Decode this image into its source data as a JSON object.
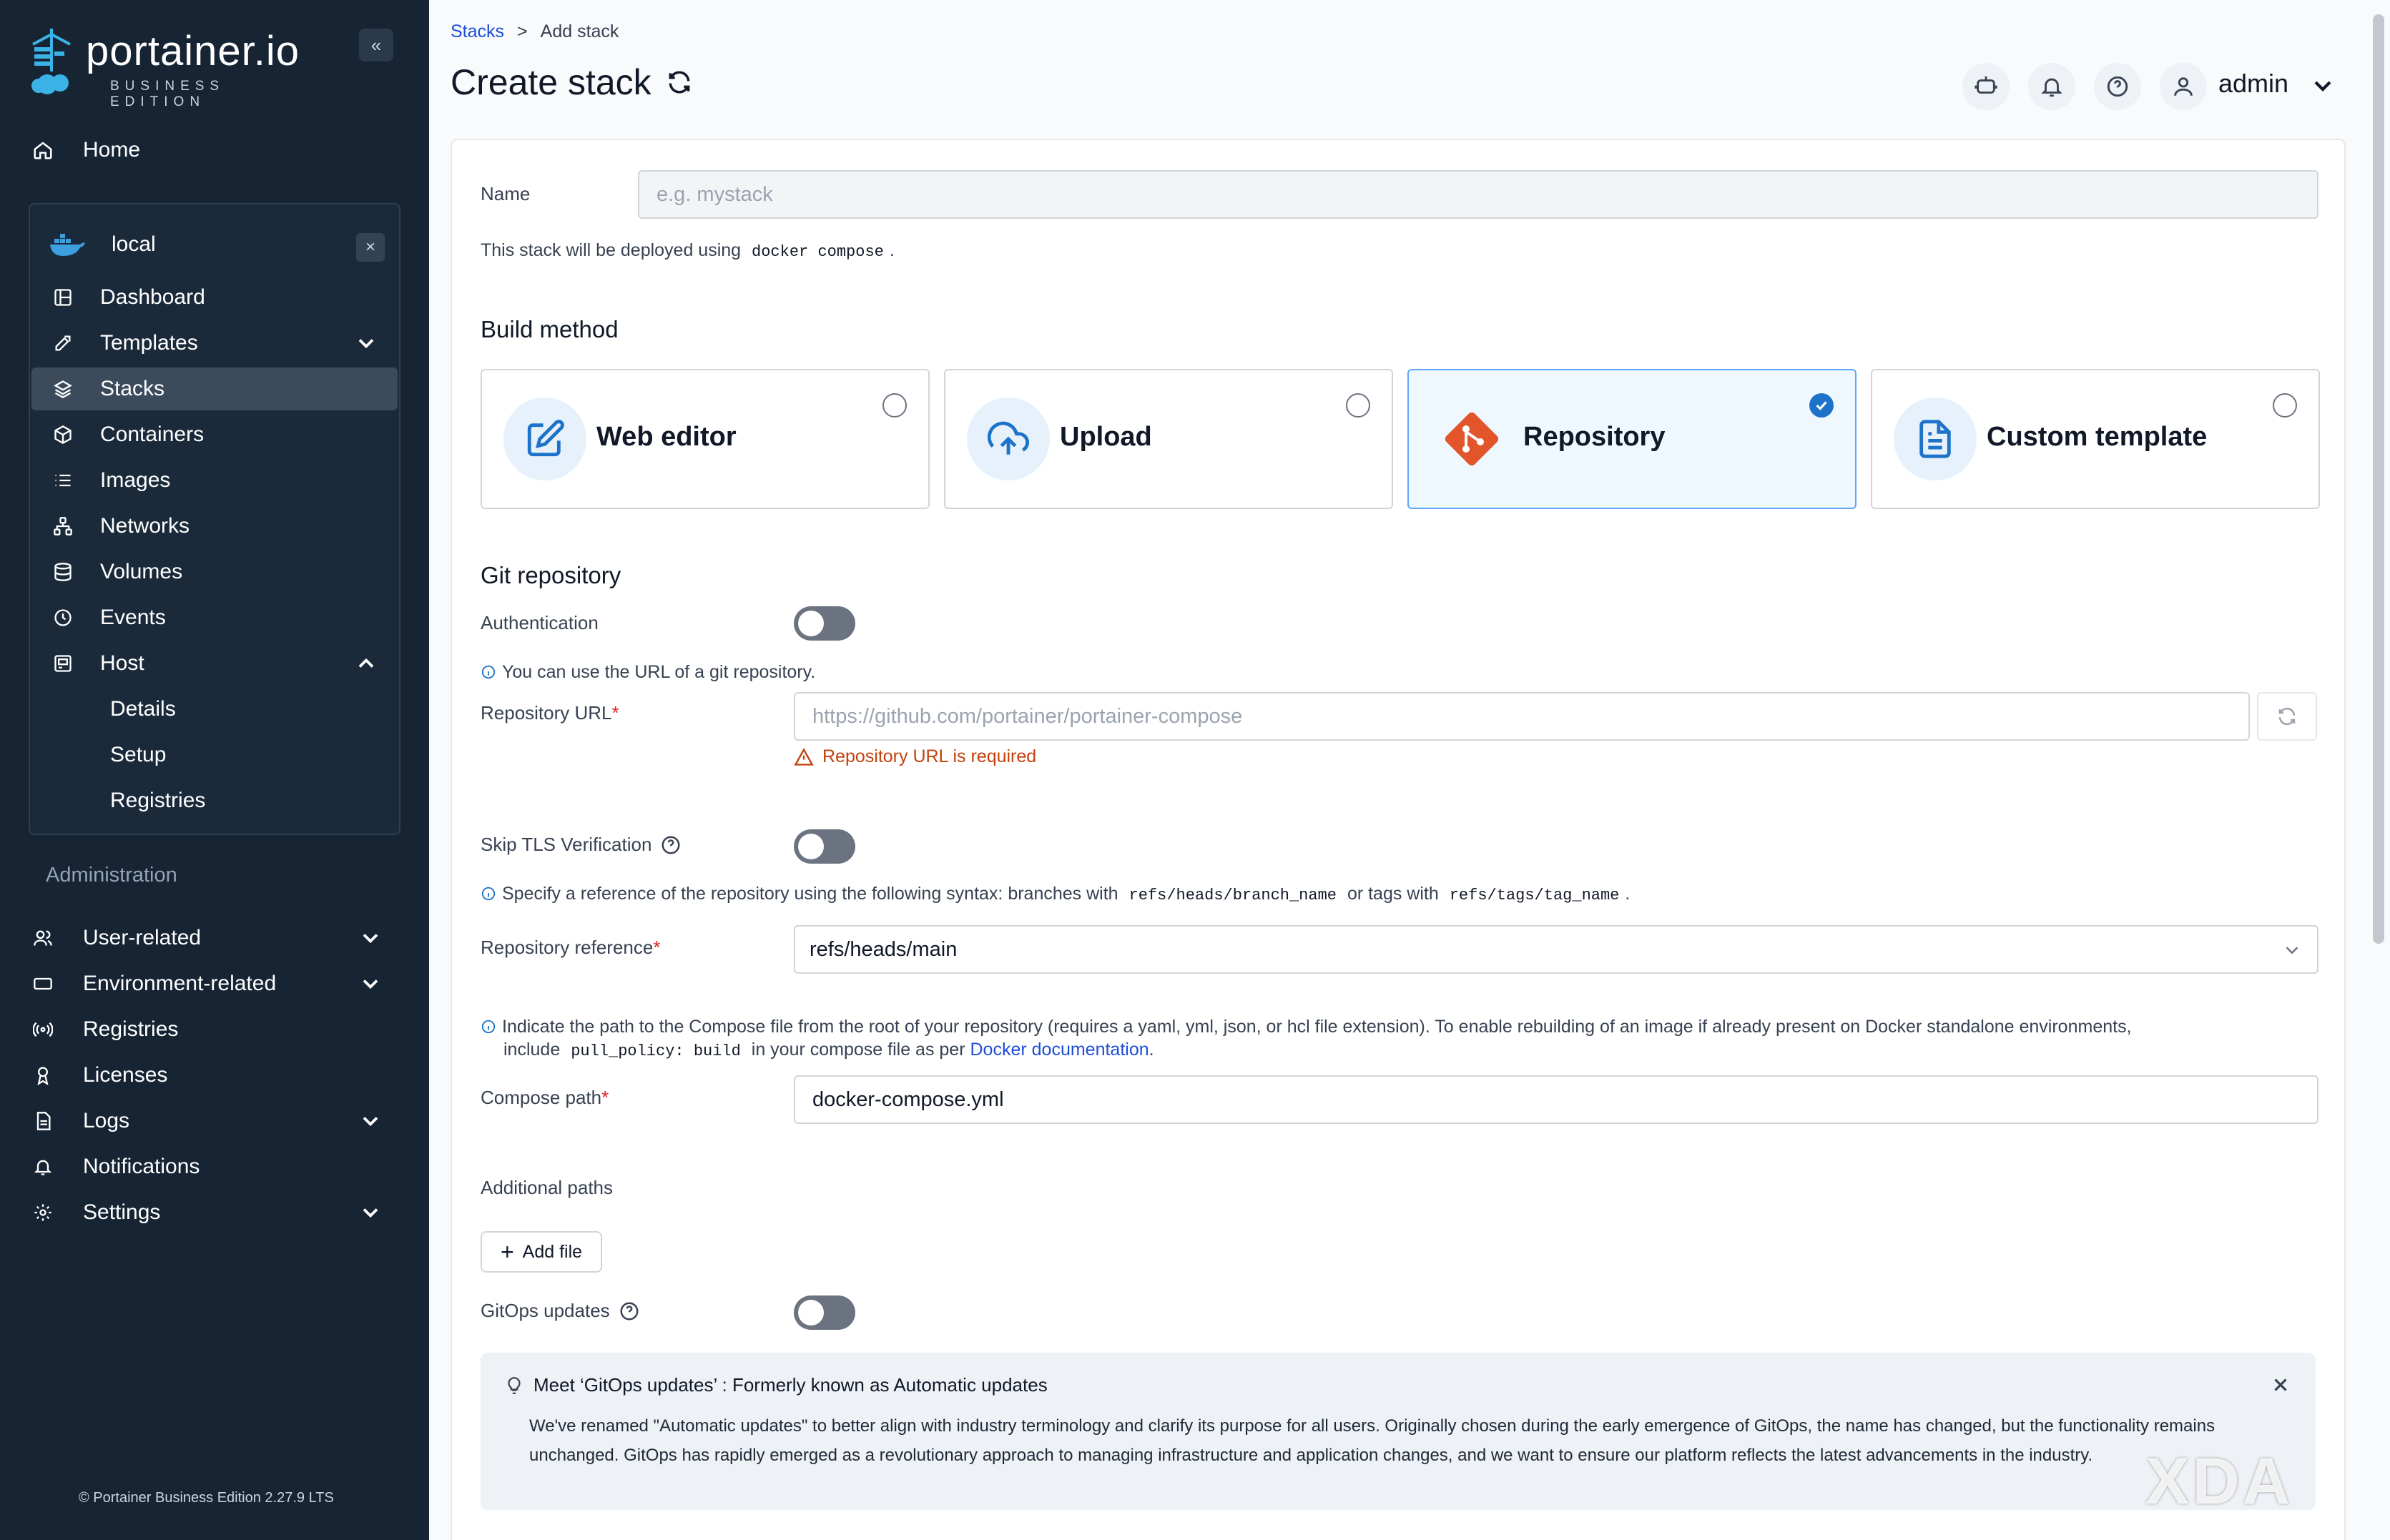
{
  "app": {
    "logo_text": "portainer.io",
    "logo_sub": "BUSINESS EDITION",
    "version_note": "© Portainer Business Edition 2.27.9 LTS"
  },
  "sidebar": {
    "home": "Home",
    "environment": {
      "name": "local",
      "items": [
        {
          "label": "Dashboard",
          "icon": "dashboard-icon"
        },
        {
          "label": "Templates",
          "icon": "templates-icon",
          "expandable": true
        },
        {
          "label": "Stacks",
          "icon": "stacks-icon",
          "active": true
        },
        {
          "label": "Containers",
          "icon": "containers-icon"
        },
        {
          "label": "Images",
          "icon": "images-icon"
        },
        {
          "label": "Networks",
          "icon": "networks-icon"
        },
        {
          "label": "Volumes",
          "icon": "volumes-icon"
        },
        {
          "label": "Events",
          "icon": "events-icon"
        },
        {
          "label": "Host",
          "icon": "host-icon",
          "expanded": true
        }
      ],
      "host_sub": [
        "Details",
        "Setup",
        "Registries"
      ]
    },
    "admin_label": "Administration",
    "admin_items": [
      {
        "label": "User-related",
        "icon": "user-icon",
        "expandable": true
      },
      {
        "label": "Environment-related",
        "icon": "environment-icon",
        "expandable": true
      },
      {
        "label": "Registries",
        "icon": "registries-icon"
      },
      {
        "label": "Licenses",
        "icon": "licenses-icon"
      },
      {
        "label": "Logs",
        "icon": "logs-icon",
        "expandable": true
      },
      {
        "label": "Notifications",
        "icon": "bell-icon"
      },
      {
        "label": "Settings",
        "icon": "settings-icon",
        "expandable": true
      }
    ]
  },
  "header": {
    "breadcrumb": {
      "parent": "Stacks",
      "sep": ">",
      "current": "Add stack"
    },
    "title": "Create stack",
    "user": "admin"
  },
  "form": {
    "name_label": "Name",
    "name_placeholder": "e.g. mystack",
    "deploy_note_pre": "This stack will be deployed using",
    "deploy_note_code": "docker compose",
    "deploy_note_post": ".",
    "build_method_title": "Build method",
    "methods": [
      {
        "label": "Web editor",
        "icon": "edit-icon",
        "selected": false
      },
      {
        "label": "Upload",
        "icon": "upload-cloud-icon",
        "selected": false
      },
      {
        "label": "Repository",
        "icon": "git-icon",
        "selected": true
      },
      {
        "label": "Custom template",
        "icon": "file-icon",
        "selected": false
      }
    ],
    "git_title": "Git repository",
    "auth_label": "Authentication",
    "auth_on": false,
    "url_note": "You can use the URL of a git repository.",
    "url_label": "Repository URL",
    "url_placeholder": "https://github.com/portainer/portainer-compose",
    "url_error": "Repository URL is required",
    "tls_label": "Skip TLS Verification",
    "tls_on": false,
    "ref_note_pre": "Specify a reference of the repository using the following syntax: branches with",
    "ref_note_code1": "refs/heads/branch_name",
    "ref_note_mid": "or tags with",
    "ref_note_code2": "refs/tags/tag_name",
    "ref_note_post": ".",
    "ref_label": "Repository reference",
    "ref_value": "refs/heads/main",
    "path_note_1": "Indicate the path to the Compose file from the root of your repository (requires a yaml, yml, json, or hcl file extension).  To enable rebuilding of an image if already present on Docker standalone environments,",
    "path_note_2_pre": "include",
    "path_note_2_code": "pull_policy: build",
    "path_note_2_mid": "in your compose file as per",
    "path_note_2_link": "Docker documentation",
    "path_note_2_post": ".",
    "path_label": "Compose path",
    "path_value": "docker-compose.yml",
    "additional_label": "Additional paths",
    "add_file": "Add file",
    "gitops_label": "GitOps updates",
    "gitops_on": false,
    "banner_title": "Meet ‘GitOps updates’ : Formerly known as Automatic updates",
    "banner_text": "We've renamed \"Automatic updates\" to better align with industry terminology and clarify its purpose for all users. Originally chosen during the early emergence of GitOps, the name has changed, but the functionality remains unchanged. GitOps has rapidly emerged as a revolutionary approach to managing infrastructure and application changes, and we want to ensure our platform reflects the latest advancements in the industry."
  },
  "watermark": "XDA",
  "colors": {
    "sidebar": "#162433",
    "accent": "#1d73c9",
    "error": "#c2410c",
    "git": "#e2552b"
  }
}
